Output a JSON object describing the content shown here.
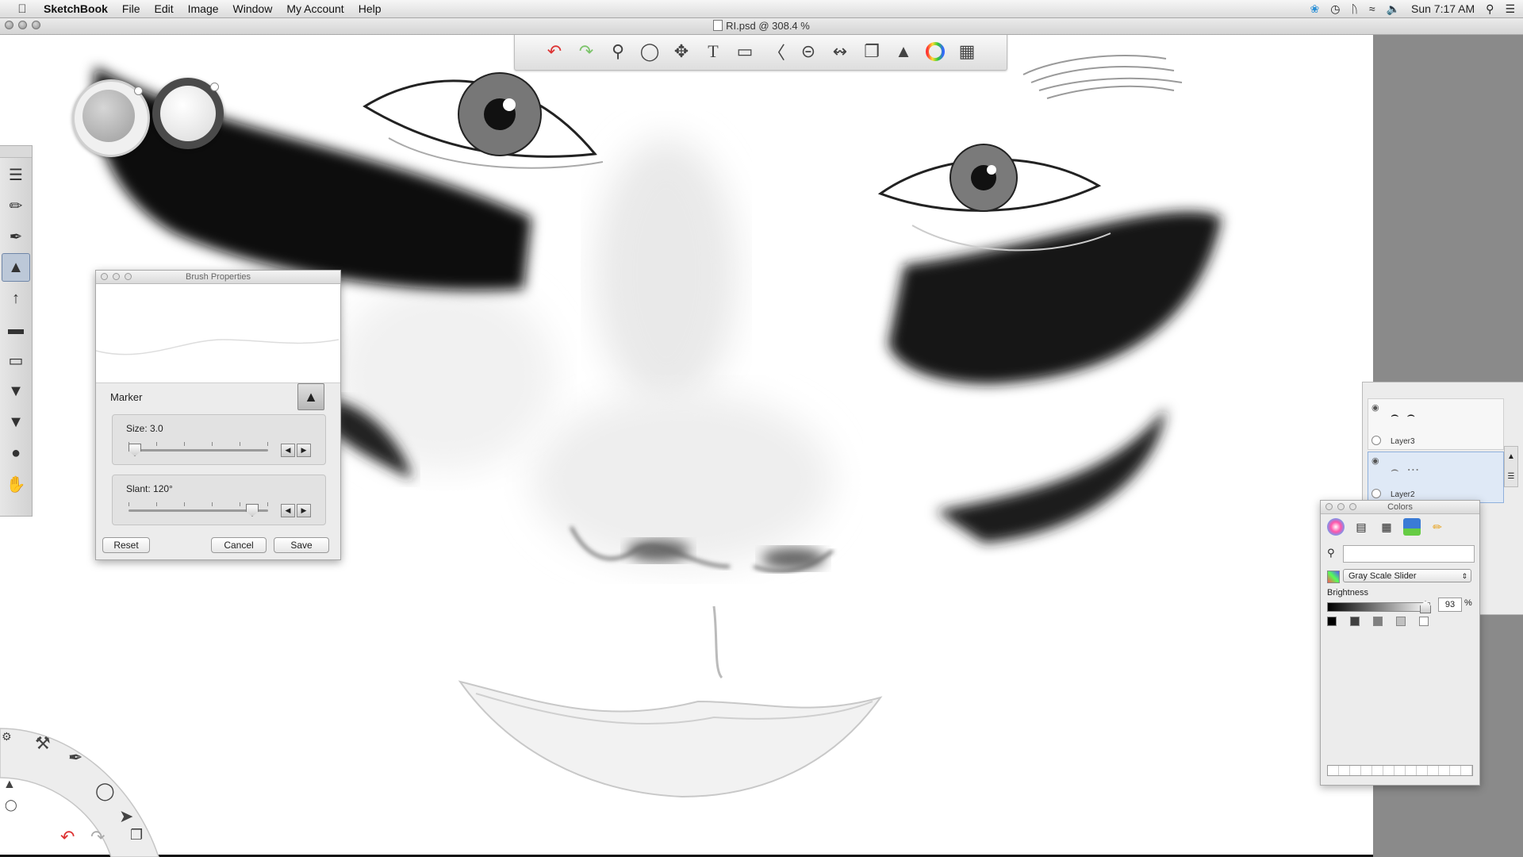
{
  "menubar": {
    "app": "SketchBook",
    "items": [
      "File",
      "Edit",
      "Image",
      "Window",
      "My Account",
      "Help"
    ],
    "clock": "Sun 7:17 AM",
    "status_icons": [
      "twitter-icon",
      "time-machine-icon",
      "bluetooth-icon",
      "wifi-icon",
      "volume-icon"
    ]
  },
  "window": {
    "title": "RI.psd @ 308.4 %"
  },
  "toolbar": {
    "tools": [
      "undo-icon",
      "redo-icon",
      "zoom-icon",
      "lasso-icon",
      "move-icon",
      "text-icon",
      "bucket-icon",
      "ruler-icon",
      "ellipse-icon",
      "symmetry-icon",
      "layers-icon",
      "brushes-icon",
      "color-wheel-icon",
      "palette-icon"
    ]
  },
  "brush_properties": {
    "title": "Brush Properties",
    "brush_name": "Marker",
    "size_label": "Size: 3.0",
    "size_value": 3.0,
    "slant_label": "Slant: 120°",
    "slant_value": 120,
    "reset": "Reset",
    "cancel": "Cancel",
    "save": "Save"
  },
  "layers": {
    "items": [
      {
        "name": "Layer3",
        "selected": false
      },
      {
        "name": "Layer2",
        "selected": true
      }
    ]
  },
  "colors": {
    "title": "Colors",
    "mode": "Gray Scale Slider",
    "brightness_label": "Brightness",
    "brightness_value": "93",
    "brightness_unit": "%"
  }
}
